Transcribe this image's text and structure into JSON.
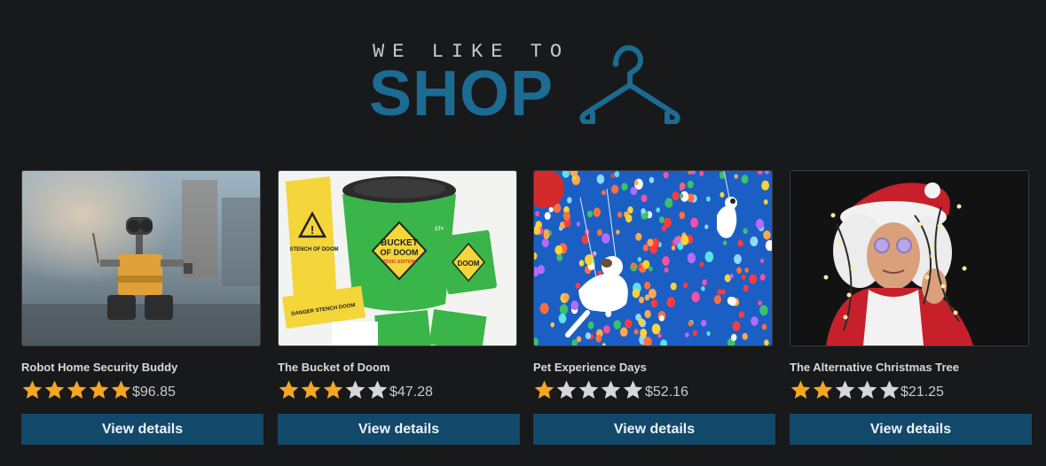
{
  "header": {
    "tagline": "WE LIKE TO",
    "wordmark": "SHOP",
    "logo_color": "#1c6b93",
    "icon": "hanger-icon"
  },
  "products": [
    {
      "title": "Robot Home Security Buddy",
      "rating": 5,
      "price": "$96.85",
      "button": "View details",
      "image": "robot-toy-photo"
    },
    {
      "title": "The Bucket of Doom",
      "rating": 3,
      "price": "$47.28",
      "button": "View details",
      "image": "bucket-of-doom-game-photo",
      "image_text": {
        "pouch": "STENCH OF DOOM",
        "bucket_line1": "BUCKET",
        "bucket_line2": "OF DOOM",
        "bucket_edition": "TOXIC EDITION",
        "card": "DOOM",
        "tape": "DANGER STENCH DOOM",
        "lid_badge": "17+"
      }
    },
    {
      "title": "Pet Experience Days",
      "rating": 1,
      "price": "$52.16",
      "button": "View details",
      "image": "dogs-with-balloons-photo"
    },
    {
      "title": "The Alternative Christmas Tree",
      "rating": 2,
      "price": "$21.25",
      "button": "View details",
      "image": "man-in-santa-hat-with-lights-photo"
    }
  ],
  "colors": {
    "background": "#18191b",
    "star_filled": "#f5a623",
    "star_empty": "#d5d7da",
    "button_bg": "#12486a"
  }
}
